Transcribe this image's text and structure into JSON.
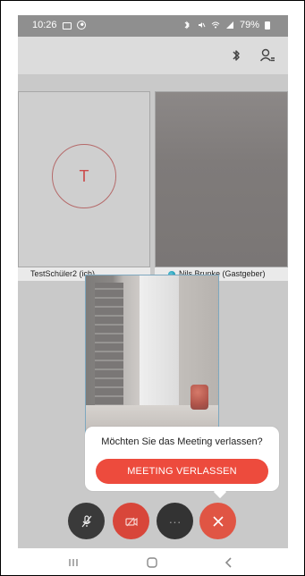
{
  "statusbar": {
    "time": "10:26",
    "battery": "79%"
  },
  "toolbar": {},
  "participants": {
    "self": {
      "initial": "T",
      "name": "TestSchüler2 (ich)"
    },
    "host": {
      "name": "Nils Brunke (Gastgeber)"
    }
  },
  "leave_dialog": {
    "question": "Möchten Sie das Meeting verlassen?",
    "button": "MEETING VERLASSEN"
  },
  "controls": {
    "more": "···"
  },
  "colors": {
    "accent": "#ed4b3d",
    "toolbar": "#dcdcdc",
    "statusbar": "#8f8f8f"
  }
}
